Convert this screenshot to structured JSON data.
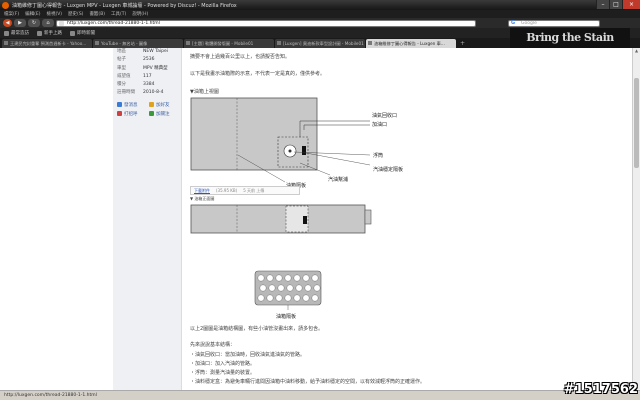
{
  "window": {
    "title": "油箱維修丁圖心得報告 - Luxgen MPV - Luxgen 車城論壇 - Powered by Discuz! - Mozilla Firefox",
    "controls": [
      "–",
      "□",
      "×"
    ]
  },
  "menu": [
    "檔案(F)",
    "編輯(E)",
    "檢視(V)",
    "歷史(S)",
    "書籤(B)",
    "工具(T)",
    "說明(H)"
  ],
  "nav": {
    "url": "http://luxgen.com/thread-21880-1-1.html",
    "search_placeholder": "Google",
    "back": "◀",
    "forward": "▶",
    "reload": "↻",
    "home": "⌂"
  },
  "bookmarks": [
    "最常造訪",
    "新手上路",
    "即時新聞"
  ],
  "tabs": [
    {
      "label": "王建民完封重奪 預測首週新卡 - Yahoo...",
      "active": false
    },
    {
      "label": "YouTube - 無名站 - 圖像",
      "active": false
    },
    {
      "label": "[主題] 軟體開發版圖 - Mobile01",
      "active": false
    },
    {
      "label": "[Luxgen] 奧迪新款車型設計圖 - Mobile01",
      "active": false
    },
    {
      "label": "油箱維修丁圖心得報告 - Luxgen 車...",
      "active": true
    }
  ],
  "brand_logo": "Bring the Stain",
  "sidebar": {
    "info": [
      {
        "k": "地區",
        "v": "NEW Taipei"
      },
      {
        "k": "帖子",
        "v": "2536"
      },
      {
        "k": "車型",
        "v": "MPV 精典型"
      },
      {
        "k": "威望值",
        "v": "117"
      },
      {
        "k": "積分",
        "v": "3384"
      },
      {
        "k": "註冊時間",
        "v": "2010-8-4"
      }
    ],
    "actions": [
      {
        "label": "發消息",
        "color": "#3a7bd5"
      },
      {
        "label": "加好友",
        "color": "#e0a020"
      },
      {
        "label": "打招呼",
        "color": "#d04040"
      },
      {
        "label": "加關注",
        "color": "#3a9a3a"
      }
    ]
  },
  "post": {
    "line1": "摘要不會上過幾百公里以上，也請擬否告知。",
    "line2": "以下是我畫示油箱際的示意，不代表一定是真的，僅供參考。",
    "section_title": "▼油箱上視圖",
    "download_label": "下載附件",
    "download_size": "(35.95 KB)",
    "download_meta": "5 天前 上傳",
    "labels_top": {
      "return": "油氣回收口",
      "inlet": "加油口",
      "float": "浮筒",
      "pump": "汽油幫浦",
      "fix": "汽油穩定隔板",
      "divider": "油箱隔板"
    },
    "side_title": "▼ 油箱正面圖",
    "divider_label": "油箱隔板",
    "body_lines": [
      "以上2圖圖是油箱結構圖，有些小油管沒畫出來，請多包含。",
      "先來說說基本結構：",
      "・油氣回收口：當加油時，回收油氣進油氣的管路。",
      "・加油口：加入汽油的管路。",
      "・浮筒：測量汽油量的裝置。",
      "・油料穩定盒：為避免車輛行進間因油箱中油料移動，給予油料穩定的空間，以有效減輕浮筒的正確運作。"
    ]
  },
  "status": "http://luxgen.com/thread-21880-1-1.html",
  "watermark": "#1517562"
}
